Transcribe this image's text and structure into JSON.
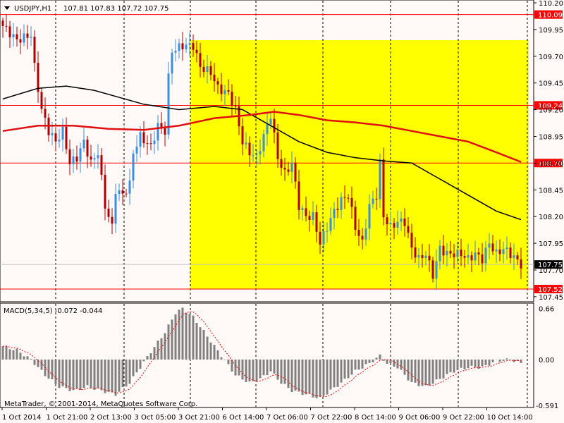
{
  "header": {
    "symbol": "USDJPY,H1",
    "ohlc": "107.81 107.83 107.72 107.75"
  },
  "price_axis": {
    "ticks": [
      "110.20",
      "109.95",
      "109.70",
      "109.45",
      "109.20",
      "108.95",
      "108.70",
      "108.45",
      "108.20",
      "107.95",
      "107.70",
      "107.45"
    ],
    "levels": [
      {
        "label": "110.09",
        "value": 110.09
      },
      {
        "label": "109.24",
        "value": 109.24
      },
      {
        "label": "108.70",
        "value": 108.7
      },
      {
        "label": "107.52",
        "value": 107.52
      }
    ],
    "bid": {
      "label": "107.75",
      "value": 107.75
    }
  },
  "macd": {
    "label": "MACD(5,34,5) -0.072 -0.044",
    "ticks": [
      "0.66",
      "0.00",
      "-0.591"
    ]
  },
  "copyright": "MetaTrader, © 2001-2014, MetaQuotes Software Corp.",
  "time_axis": [
    "1 Oct 2014",
    "1 Oct 21:00",
    "2 Oct 13:00",
    "3 Oct 05:00",
    "3 Oct 21:00",
    "6 Oct 14:00",
    "7 Oct 06:00",
    "7 Oct 22:00",
    "8 Oct 14:00",
    "9 Oct 06:00",
    "9 Oct 22:00",
    "10 Oct 14:00"
  ],
  "colors": {
    "up": "#3a8fe0",
    "down": "#b00000",
    "level": "#ff0000",
    "highlight": "#ffff00",
    "sma": "#000000",
    "ma": "#e01010"
  },
  "chart_data": {
    "type": "line",
    "title": "USDJPY,H1",
    "highlight_range": [
      109.85,
      107.52
    ],
    "close_path": [
      [
        1,
        109.95
      ],
      [
        4,
        109.85
      ],
      [
        8,
        109.9
      ],
      [
        9,
        109.6
      ],
      [
        11,
        109.2
      ],
      [
        13,
        109.0
      ],
      [
        15,
        108.9
      ],
      [
        17,
        109.0
      ],
      [
        19,
        108.7
      ],
      [
        21,
        108.75
      ],
      [
        23,
        108.9
      ],
      [
        25,
        108.7
      ],
      [
        27,
        108.8
      ],
      [
        29,
        108.3
      ],
      [
        31,
        108.1
      ],
      [
        32,
        108.45
      ],
      [
        34,
        108.4
      ],
      [
        36,
        108.5
      ],
      [
        37,
        108.8
      ],
      [
        39,
        108.95
      ],
      [
        42,
        108.85
      ],
      [
        44,
        109.05
      ],
      [
        46,
        109.0
      ],
      [
        47,
        109.5
      ],
      [
        48,
        109.75
      ],
      [
        51,
        109.8
      ],
      [
        54,
        109.8
      ],
      [
        56,
        109.6
      ],
      [
        59,
        109.55
      ],
      [
        61,
        109.4
      ],
      [
        64,
        109.35
      ],
      [
        66,
        109.2
      ],
      [
        68,
        108.9
      ],
      [
        70,
        108.8
      ],
      [
        72,
        108.75
      ],
      [
        74,
        108.95
      ],
      [
        76,
        109.15
      ],
      [
        78,
        108.75
      ],
      [
        80,
        108.6
      ],
      [
        82,
        108.7
      ],
      [
        84,
        108.3
      ],
      [
        86,
        108.2
      ],
      [
        88,
        108.2
      ],
      [
        90,
        107.95
      ],
      [
        92,
        108.1
      ],
      [
        94,
        108.25
      ],
      [
        96,
        108.35
      ],
      [
        98,
        108.4
      ],
      [
        100,
        108.1
      ],
      [
        102,
        107.95
      ],
      [
        104,
        108.3
      ],
      [
        106,
        108.4
      ],
      [
        107,
        108.7
      ],
      [
        108,
        108.2
      ],
      [
        110,
        108.1
      ],
      [
        112,
        108.15
      ],
      [
        114,
        108.15
      ],
      [
        116,
        107.9
      ],
      [
        118,
        107.8
      ],
      [
        120,
        107.85
      ],
      [
        122,
        107.65
      ],
      [
        124,
        107.9
      ],
      [
        126,
        107.85
      ],
      [
        128,
        107.85
      ],
      [
        130,
        107.85
      ],
      [
        132,
        107.8
      ],
      [
        134,
        107.85
      ],
      [
        136,
        107.8
      ],
      [
        138,
        107.95
      ],
      [
        140,
        107.85
      ],
      [
        142,
        107.9
      ],
      [
        144,
        107.85
      ],
      [
        147,
        107.75
      ]
    ],
    "sma_path": [
      [
        0,
        109.3
      ],
      [
        10,
        109.4
      ],
      [
        18,
        109.42
      ],
      [
        26,
        109.38
      ],
      [
        40,
        109.25
      ],
      [
        50,
        109.2
      ],
      [
        60,
        109.23
      ],
      [
        68,
        109.2
      ],
      [
        76,
        109.05
      ],
      [
        84,
        108.9
      ],
      [
        92,
        108.8
      ],
      [
        100,
        108.75
      ],
      [
        108,
        108.72
      ],
      [
        116,
        108.7
      ],
      [
        124,
        108.55
      ],
      [
        132,
        108.4
      ],
      [
        140,
        108.25
      ],
      [
        147,
        108.17
      ]
    ],
    "ma_path": [
      [
        0,
        109.0
      ],
      [
        10,
        109.05
      ],
      [
        20,
        109.05
      ],
      [
        30,
        109.02
      ],
      [
        40,
        109.01
      ],
      [
        50,
        109.05
      ],
      [
        60,
        109.12
      ],
      [
        70,
        109.15
      ],
      [
        77,
        109.18
      ],
      [
        84,
        109.15
      ],
      [
        92,
        109.1
      ],
      [
        100,
        109.08
      ],
      [
        108,
        109.05
      ],
      [
        116,
        109.0
      ],
      [
        124,
        108.95
      ],
      [
        132,
        108.9
      ],
      [
        140,
        108.8
      ],
      [
        147,
        108.71
      ]
    ],
    "macd_path": [
      [
        0,
        0.17
      ],
      [
        4,
        0.12
      ],
      [
        8,
        0.0
      ],
      [
        12,
        -0.2
      ],
      [
        16,
        -0.35
      ],
      [
        20,
        -0.4
      ],
      [
        24,
        -0.35
      ],
      [
        28,
        -0.4
      ],
      [
        32,
        -0.45
      ],
      [
        36,
        -0.3
      ],
      [
        39,
        -0.1
      ],
      [
        42,
        0.1
      ],
      [
        46,
        0.35
      ],
      [
        49,
        0.6
      ],
      [
        51,
        0.66
      ],
      [
        54,
        0.55
      ],
      [
        58,
        0.3
      ],
      [
        62,
        0.05
      ],
      [
        66,
        -0.2
      ],
      [
        70,
        -0.3
      ],
      [
        73,
        -0.25
      ],
      [
        76,
        -0.15
      ],
      [
        79,
        -0.3
      ],
      [
        82,
        -0.4
      ],
      [
        86,
        -0.45
      ],
      [
        90,
        -0.5
      ],
      [
        93,
        -0.4
      ],
      [
        96,
        -0.3
      ],
      [
        100,
        -0.15
      ],
      [
        104,
        -0.05
      ],
      [
        107,
        0.05
      ],
      [
        109,
        -0.05
      ],
      [
        112,
        -0.1
      ],
      [
        116,
        -0.3
      ],
      [
        120,
        -0.35
      ],
      [
        124,
        -0.25
      ],
      [
        128,
        -0.15
      ],
      [
        132,
        -0.1
      ],
      [
        136,
        -0.1
      ],
      [
        140,
        -0.02
      ],
      [
        144,
        0.0
      ],
      [
        147,
        -0.05
      ]
    ],
    "ylim": [
      107.45,
      110.2
    ],
    "macd_ylim": [
      -0.591,
      0.66
    ]
  }
}
